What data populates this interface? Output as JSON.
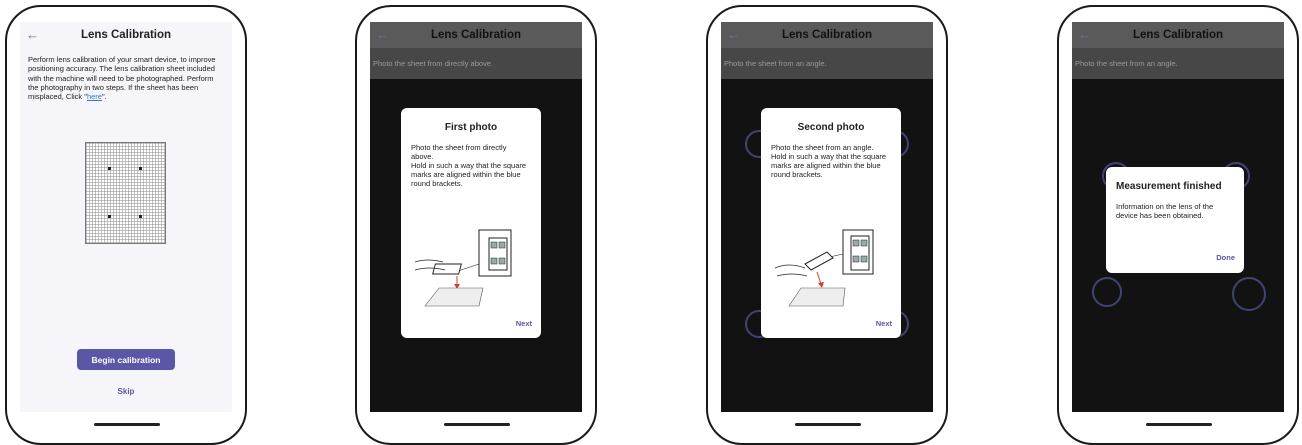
{
  "screens": {
    "calibration": {
      "title": "Lens Calibration",
      "intro_text": "Perform lens calibration of your smart device, to improve positioning accuracy. The lens calibration sheet included with the machine will need to be photographed. Perform the photography in two steps. If the sheet has been misplaced, Click \"",
      "here_link": "here",
      "intro_end": "\".",
      "begin_button": "Begin calibration",
      "skip_button": "Skip"
    },
    "first_photo": {
      "title": "Lens Calibration",
      "instruction": "Photo the sheet from directly above.",
      "dialog_title": "First photo",
      "dialog_body": "Photo the sheet from directly above.\nHold in such a way that the square marks are aligned within the blue round brackets.",
      "dialog_button": "Next"
    },
    "second_photo": {
      "title": "Lens Calibration",
      "instruction": "Photo the sheet from an angle.",
      "dialog_title": "Second photo",
      "dialog_body": "Photo the sheet from an angle.\nHold in such a way that the square marks are aligned within the blue round brackets.",
      "dialog_button": "Next"
    },
    "finished": {
      "title": "Lens Calibration",
      "instruction": "Photo the sheet from an angle.",
      "dialog_title": "Measurement finished",
      "dialog_body": "Information on the lens of the device has been obtained.",
      "dialog_button": "Done"
    }
  },
  "icons": {
    "back": "back-arrow-icon"
  },
  "colors": {
    "accent": "#5b57a6",
    "link": "#2f78c4",
    "dark_bg": "#121212",
    "appbar_dark": "#5a5a5a"
  }
}
